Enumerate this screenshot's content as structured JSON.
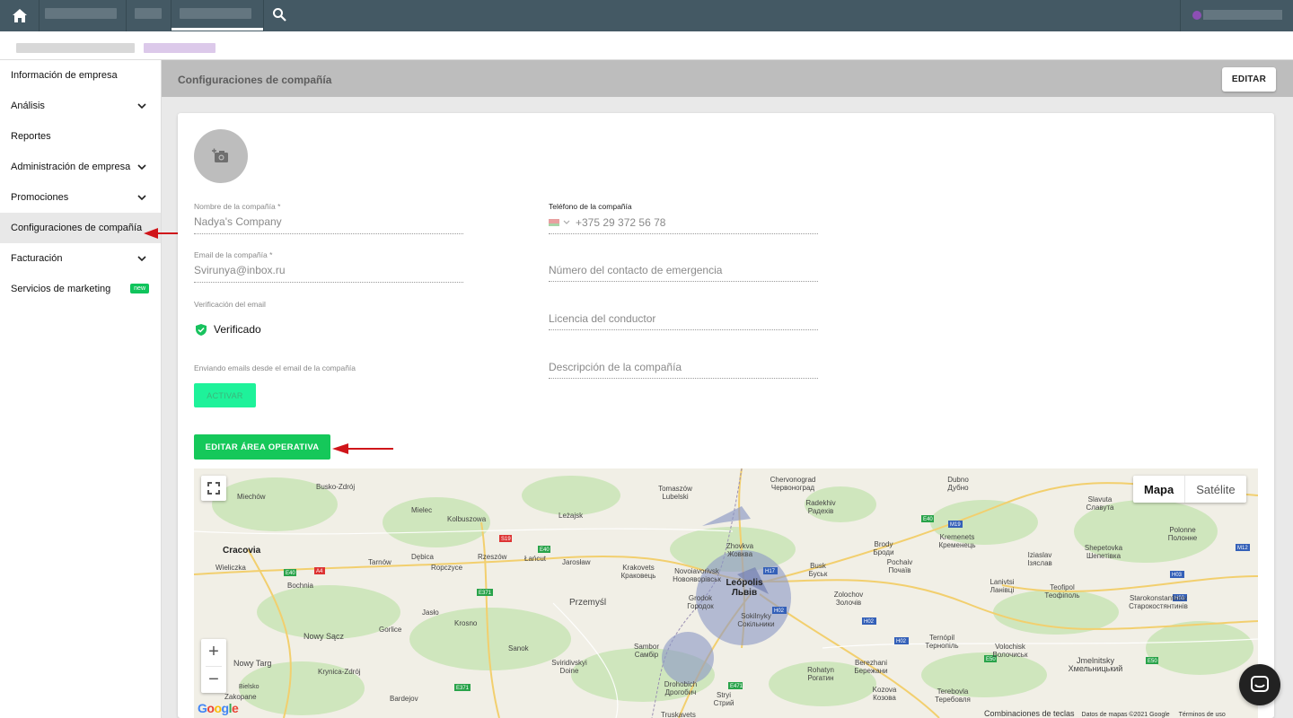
{
  "topbar": {
    "icons": {
      "home": "home-icon",
      "search": "search-icon"
    }
  },
  "sidebar": {
    "items": [
      {
        "label": "Información de empresa",
        "expandable": false
      },
      {
        "label": "Análisis",
        "expandable": true
      },
      {
        "label": "Reportes",
        "expandable": false
      },
      {
        "label": "Administración de empresa",
        "expandable": true
      },
      {
        "label": "Promociones",
        "expandable": true
      },
      {
        "label": "Configuraciones de compañía",
        "expandable": false,
        "active": true
      },
      {
        "label": "Facturación",
        "expandable": true
      },
      {
        "label": "Servicios de marketing",
        "expandable": false,
        "badge": "new"
      }
    ]
  },
  "header": {
    "title": "Configuraciones de compañía",
    "edit_label": "EDITAR"
  },
  "form": {
    "company_name": {
      "label": "Nombre de la compañía *",
      "value": "Nadya's Company"
    },
    "company_phone": {
      "label": "Teléfono de la compañía",
      "value": "+375 29 372 56 78"
    },
    "company_email": {
      "label": "Email de la compañía *",
      "value": "Svirunya@inbox.ru"
    },
    "emergency_contact": {
      "placeholder": "Número del contacto de emergencia"
    },
    "email_verification": {
      "label": "Verificación del email",
      "status": "Verificado"
    },
    "driver_license": {
      "placeholder": "Licencia del conductor"
    },
    "sending_emails": {
      "label": "Enviando emails desde el email de la compañía",
      "button": "ACTIVAR"
    },
    "company_description": {
      "placeholder": "Descripción de la compañía"
    }
  },
  "operating_area": {
    "button": "EDITAR ÁREA OPERATIVA"
  },
  "map": {
    "type_options": [
      "Mapa",
      "Satélite"
    ],
    "selected_type": "Mapa",
    "zoom_in": "+",
    "zoom_out": "−",
    "footer": {
      "shortcuts": "Combinaciones de teclas",
      "data": "Datos de mapas ©2021 Google",
      "terms": "Términos de uso"
    },
    "labels": [
      "Busko-Zdrój",
      "Tomaszów Lubelski",
      "Chervonograd Червоноград",
      "Dubno Дубно",
      "Miechów",
      "Mielec",
      "Kolbuszowa",
      "Leżajsk",
      "Radekhiv Радехів",
      "Slavuta Славута",
      "Cracovia",
      "Wieliczka",
      "Tarnów",
      "Dębica",
      "Rzeszów",
      "Łańcut",
      "Jarosław",
      "Zhovkva Жовква",
      "Brody Броди",
      "Kremenets Кременець",
      "Shepetovka Шепетівка",
      "Bochnia",
      "Ropczyce",
      "Krakovets Краковець",
      "Novoiavorivsk Новояворівськ",
      "Busk Буськ",
      "Pochaiv Почаїв",
      "Iziaslav Ізяслав",
      "Polonne Полонне",
      "Leópolis Львів",
      "Przemyśl",
      "Grodok Городок",
      "Zolochov Золочів",
      "Lanivtsi Ланівці",
      "Teofipol Теофіполь",
      "Jasło",
      "Krosno",
      "Sokilnyky Сокільники",
      "Starokonstantinov Старокостянтинів",
      "Nowy Sącz",
      "Gorlice",
      "Sanok",
      "Sambor Самбір",
      "Ternópil Тернопіль",
      "Volochisk Волочиськ",
      "Nowy Targ",
      "Krynica-Zdrój",
      "Sviridivskyi Doine",
      "Drohobich Дрогобич",
      "Rohatyn Рогатин",
      "Berezhani Бережани",
      "Jmelnitsky Хмельницький",
      "Zakopane",
      "Bardejov",
      "Stryi Стрий",
      "Kozova Козова",
      "Terebovla Теребовля",
      "Truskavets",
      "Bielsko"
    ]
  },
  "colors": {
    "topbar": "#445964",
    "accent_green": "#15c85a",
    "activar_green": "#1ef29a",
    "badge_green": "#10c45c",
    "arrow_red": "#d0151a",
    "area_fill": "#8b96c4"
  }
}
